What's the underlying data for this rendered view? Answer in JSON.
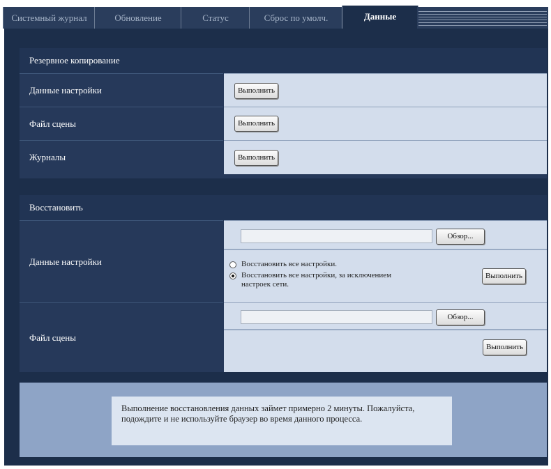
{
  "tabs": [
    {
      "label": "Системный журнал",
      "active": false
    },
    {
      "label": "Обновление",
      "active": false
    },
    {
      "label": "Статус",
      "active": false
    },
    {
      "label": "Сброс по умолч.",
      "active": false
    },
    {
      "label": "Данные",
      "active": true
    }
  ],
  "backup": {
    "title": "Резервное копирование",
    "rows": [
      {
        "label": "Данные настройки",
        "button": "Выполнить"
      },
      {
        "label": "Файл сцены",
        "button": "Выполнить"
      },
      {
        "label": "Журналы",
        "button": "Выполнить"
      }
    ]
  },
  "restore": {
    "title": "Восстановить",
    "settings": {
      "label": "Данные настройки",
      "file_value": "",
      "browse": "Обзор...",
      "option1": "Восстановить все настройки.",
      "option2": "Восстановить все настройки, за исключением настроек сети.",
      "selected": 2,
      "button": "Выполнить"
    },
    "scene": {
      "label": "Файл сцены",
      "file_value": "",
      "browse": "Обзор...",
      "button": "Выполнить"
    }
  },
  "notice": "Выполнение восстановления данных займет примерно 2 минуты. Пожалуйста, подождите и не используйте браузер во время данного процесса."
}
